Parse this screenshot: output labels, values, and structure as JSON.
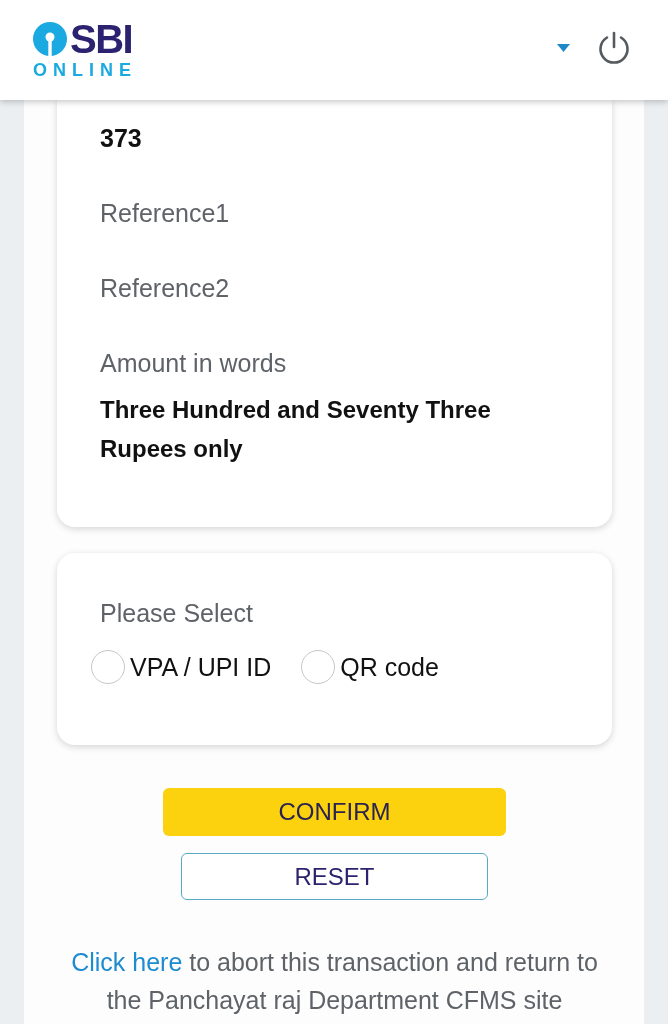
{
  "header": {
    "logo": {
      "wordmark": "SBI",
      "subtitle": "ONLINE"
    }
  },
  "details_card": {
    "amount": "373",
    "fields": [
      {
        "label": "Reference1"
      },
      {
        "label": "Reference2"
      },
      {
        "label": "Amount in words",
        "value": "Three Hundred and Seventy Three Rupees only"
      }
    ]
  },
  "payment_card": {
    "prompt": "Please Select",
    "options": [
      {
        "label": "VPA / UPI ID",
        "selected": false
      },
      {
        "label": "QR code",
        "selected": false
      }
    ]
  },
  "buttons": [
    {
      "kind": "primary",
      "label": "CONFIRM"
    },
    {
      "kind": "outline",
      "label": "RESET"
    }
  ],
  "footer_note": {
    "link": "Click here",
    "text": "to abort this transaction and return to the Panchayat raj Department CFMS site"
  }
}
